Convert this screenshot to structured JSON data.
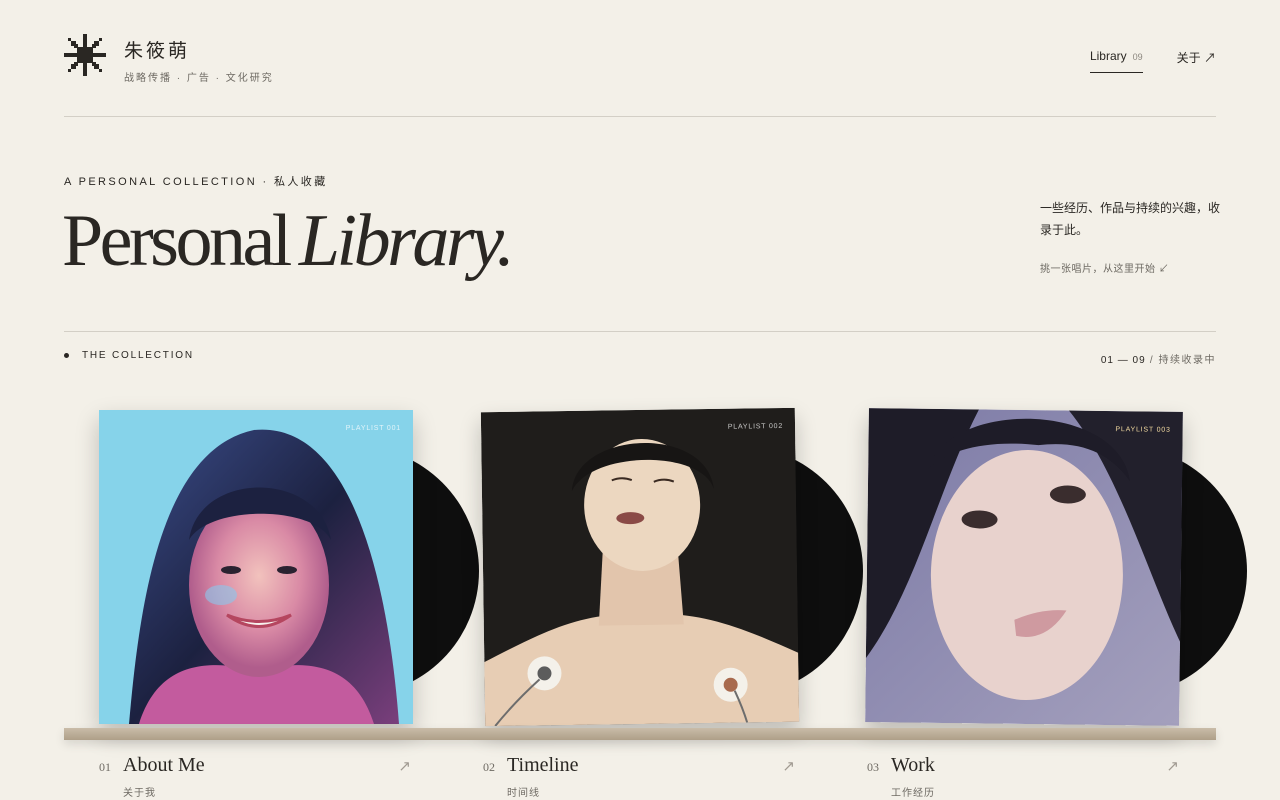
{
  "brand": {
    "name": "朱筱萌",
    "subtitle": "战略传播 · 广告 · 文化研究"
  },
  "nav": {
    "library_label": "Library",
    "library_count": "09",
    "about_label": "关于 ↗"
  },
  "hero": {
    "eyebrow": "A PERSONAL COLLECTION · 私人收藏",
    "title_regular": "Personal",
    "title_italic": "Library.",
    "intro": "一些经历、作品与持续的兴趣，收录于此。",
    "start_hint": "挑一张唱片，从这里开始 ↙"
  },
  "collection": {
    "label": "THE COLLECTION",
    "range": "01 — 09",
    "range_sep": " / ",
    "status": "持续收录中"
  },
  "records": [
    {
      "number": "01",
      "title": "About Me",
      "subtitle": "关于我",
      "tag": "PLAYLIST 001",
      "arrow": "↗"
    },
    {
      "number": "02",
      "title": "Timeline",
      "subtitle": "时间线",
      "tag": "PLAYLIST 002",
      "arrow": "↗"
    },
    {
      "number": "03",
      "title": "Work",
      "subtitle": "工作经历",
      "tag": "PLAYLIST 003",
      "arrow": "↗"
    }
  ],
  "colors": {
    "background": "#f3f0e8",
    "ink": "#2a2723",
    "muted": "#6e6a63",
    "shelf": "#b8aa94",
    "cover1_bg": "#86d3ea",
    "cover2_bg": "#1f1d1b",
    "cover3_bg": "#7d7a9a"
  }
}
